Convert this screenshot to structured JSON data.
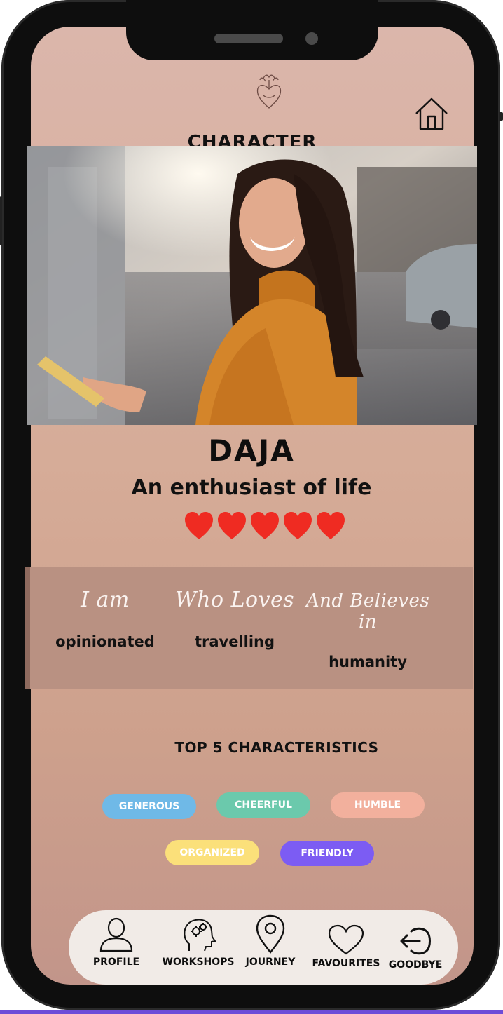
{
  "header": {
    "title": "CHARACTER",
    "logo_icon": "heart-logo-icon",
    "home_icon": "home-icon"
  },
  "profile": {
    "name": "DAJA",
    "tagline": "An enthusiast of life",
    "rating": 5,
    "rating_max": 5,
    "rating_color": "#ef2b22"
  },
  "traits": [
    {
      "heading": "I am",
      "value": "opinionated"
    },
    {
      "heading": "Who Loves",
      "value": "travelling"
    },
    {
      "heading": "And Believes in",
      "value": "humanity"
    }
  ],
  "characteristics": {
    "title": "TOP 5 CHARACTERISTICS",
    "items": [
      {
        "label": "GENEROUS",
        "color": "#6fb9e7"
      },
      {
        "label": "CHEERFUL",
        "color": "#6bc9ac"
      },
      {
        "label": "HUMBLE",
        "color": "#f2b09d"
      },
      {
        "label": "ORGANIZED",
        "color": "#fbe07a"
      },
      {
        "label": "FRIENDLY",
        "color": "#7c5cf3"
      }
    ]
  },
  "nav": [
    {
      "label": "PROFILE",
      "icon": "user-icon"
    },
    {
      "label": "WORKSHOPS",
      "icon": "head-gears-icon"
    },
    {
      "label": "JOURNEY",
      "icon": "map-pin-icon"
    },
    {
      "label": "FAVOURITES",
      "icon": "heart-outline-icon"
    },
    {
      "label": "GOODBYE",
      "icon": "logout-icon"
    }
  ]
}
